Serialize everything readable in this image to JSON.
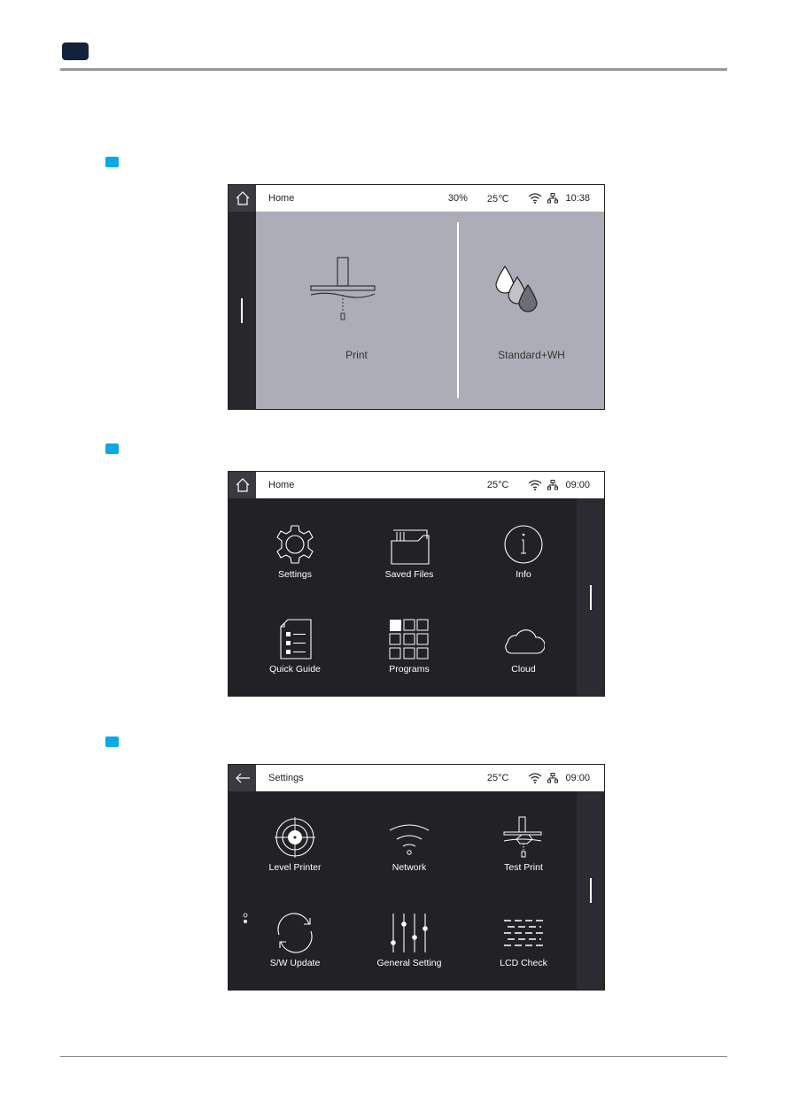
{
  "screens": [
    {
      "title": "Home",
      "nav_icon": "home-icon",
      "humidity": "30%",
      "temperature": "25℃",
      "time": "10:38",
      "tiles": [
        {
          "label": "Print",
          "icon": "printhead-icon"
        },
        {
          "label": "Standard+WH",
          "icon": "ink-drops-icon"
        }
      ]
    },
    {
      "title": "Home",
      "nav_icon": "home-icon",
      "temperature": "25°C",
      "time": "09:00",
      "items": [
        {
          "label": "Settings",
          "icon": "gear-icon"
        },
        {
          "label": "Saved Files",
          "icon": "folder-icon"
        },
        {
          "label": "Info",
          "icon": "info-icon"
        },
        {
          "label": "Quick Guide",
          "icon": "document-list-icon"
        },
        {
          "label": "Programs",
          "icon": "grid-icon"
        },
        {
          "label": "Cloud",
          "icon": "cloud-icon"
        }
      ]
    },
    {
      "title": "Settings",
      "nav_icon": "back-arrow-icon",
      "temperature": "25°C",
      "time": "09:00",
      "items": [
        {
          "label": "Level Printer",
          "icon": "target-icon"
        },
        {
          "label": "Network",
          "icon": "wifi-icon"
        },
        {
          "label": "Test Print",
          "icon": "test-print-icon"
        },
        {
          "label": "S/W Update",
          "icon": "refresh-icon"
        },
        {
          "label": "General Setting",
          "icon": "sliders-icon"
        },
        {
          "label": "LCD Check",
          "icon": "lcd-pattern-icon"
        }
      ]
    }
  ],
  "colors": {
    "chapter_badge": "#14213d",
    "step_badge": "#0aa9e6",
    "panel_bg": "#adadb7",
    "dark_bg": "#222226"
  }
}
